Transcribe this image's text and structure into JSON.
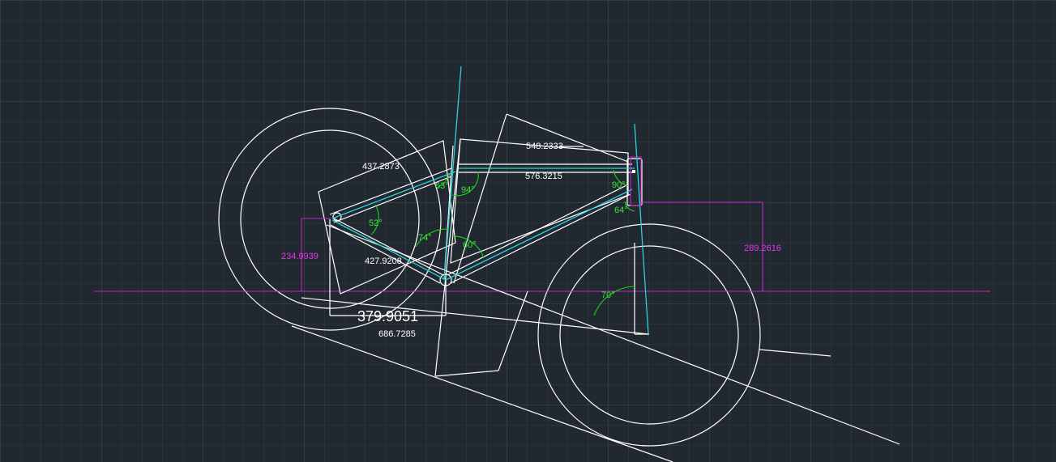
{
  "colors": {
    "background": "#212830",
    "grid_minor": "#2a323c",
    "grid_major": "#323c47",
    "geometry": "#ffffff",
    "frame_centerline": "#27d4dc",
    "angle_dimension": "#17d317",
    "linear_dimension": "#c026c8"
  },
  "dimensions": {
    "top_tube_upper": "548.2333",
    "top_tube_lower": "576.3215",
    "seat_stay": "437.2873",
    "chain_stay": "427.9208",
    "rear_axle_height": "234.9939",
    "head_tube_height": "289.2616",
    "bottom_bracket_offset": "379.9051",
    "wheelbase_segment": "686.7285"
  },
  "angles": {
    "seat_top": "63°",
    "seat_top_right": "94°",
    "head_top": "90°",
    "head_bottom": "64°",
    "rear_triangle": "52°",
    "bb_left": "74°",
    "bb_right": "60°",
    "head_ground": "70°"
  }
}
